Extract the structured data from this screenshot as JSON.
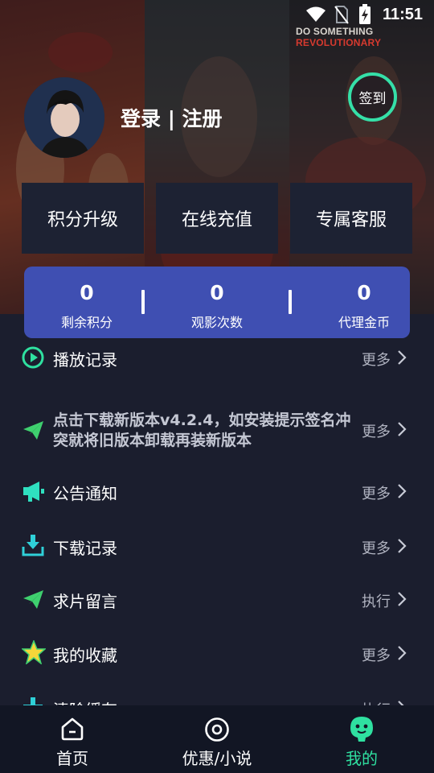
{
  "status_bar": {
    "time": "11:51"
  },
  "hero": {
    "poster_caption_a": "DO SOMETHING ",
    "poster_caption_b": "REVOLUTIONARY"
  },
  "profile": {
    "login_label": "登录 | 注册",
    "signin_label": "签到"
  },
  "quick_actions": [
    {
      "label": "积分升级"
    },
    {
      "label": "在线充值"
    },
    {
      "label": "专属客服"
    }
  ],
  "stats": [
    {
      "value": "0",
      "label": "剩余积分"
    },
    {
      "value": "0",
      "label": "观影次数"
    },
    {
      "value": "0",
      "label": "代理金币"
    }
  ],
  "menu": [
    {
      "label": "播放记录",
      "action": "更多",
      "icon": "play-circle-icon"
    },
    {
      "label": "点击下载新版本v4.2.4，如安装提示签名冲突就将旧版本卸载再装新版本",
      "action": "更多",
      "icon": "paper-plane-icon"
    },
    {
      "label": "公告通知",
      "action": "更多",
      "icon": "megaphone-icon"
    },
    {
      "label": "下载记录",
      "action": "更多",
      "icon": "download-tray-icon"
    },
    {
      "label": "求片留言",
      "action": "执行",
      "icon": "paper-plane-icon"
    },
    {
      "label": "我的收藏",
      "action": "更多",
      "icon": "star-icon"
    },
    {
      "label": "清除缓存",
      "action": "执行",
      "icon": "plus-icon"
    }
  ],
  "bottom_nav": [
    {
      "label": "首页",
      "icon": "home-icon"
    },
    {
      "label": "优惠/小说",
      "icon": "target-icon"
    },
    {
      "label": "我的",
      "icon": "mascot-face-icon",
      "active": true
    }
  ],
  "colors": {
    "accent_green": "#2fe0a0",
    "stats_card": "#3f4fb2",
    "background": "#1b1e2e",
    "nav_background": "#121624"
  }
}
